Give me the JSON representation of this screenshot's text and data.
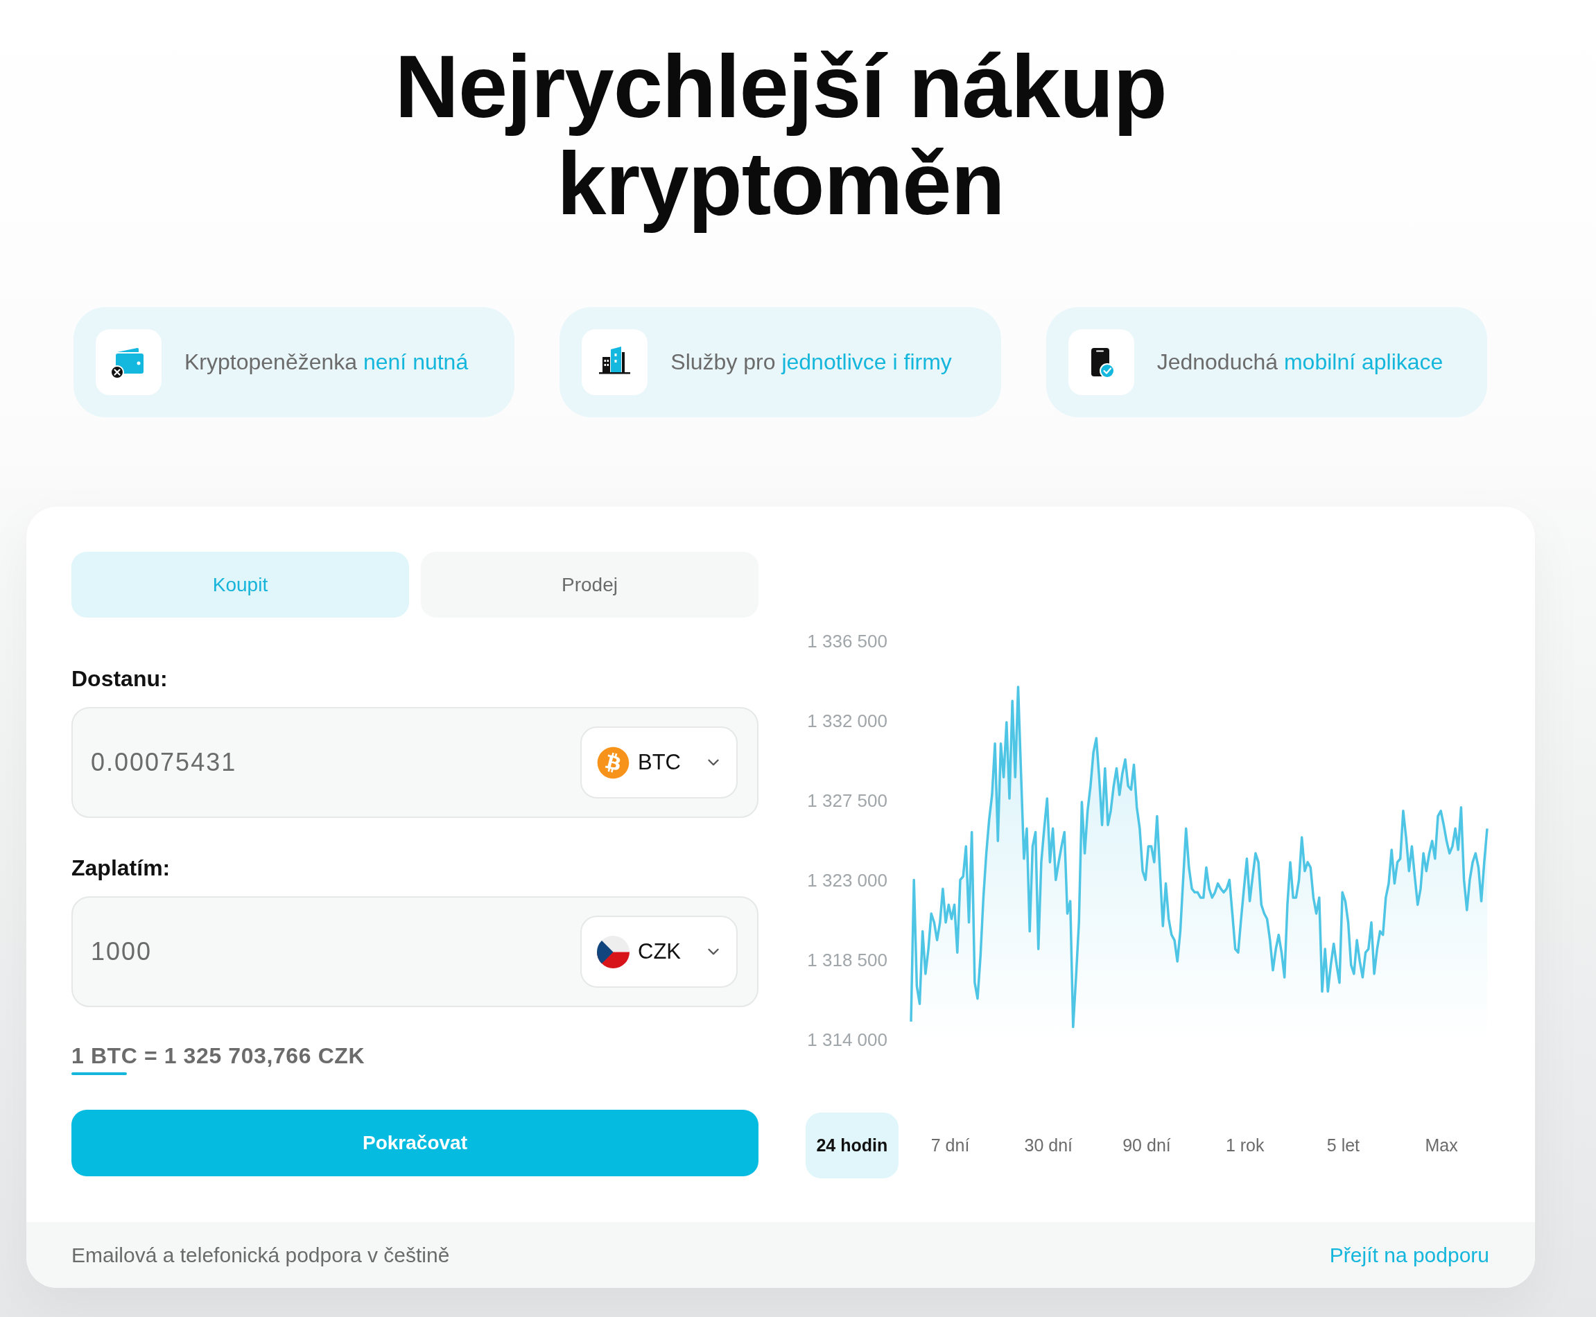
{
  "title": "Nejrychlejší nákup kryptoměn",
  "features": [
    {
      "text": "Kryptopeněženka",
      "highlight": "není nutná"
    },
    {
      "text": "Služby pro",
      "highlight": "jednotlivce i firmy"
    },
    {
      "text": "Jednoduchá",
      "highlight": "mobilní aplikace"
    }
  ],
  "trade": {
    "tabs": [
      {
        "label": "Koupit",
        "selected": true
      },
      {
        "label": "Prodej",
        "selected": false
      }
    ],
    "fields": [
      {
        "label": "Dostanu:",
        "value": "0.00075431",
        "currency": "BTC"
      },
      {
        "label": "Zaplatím:",
        "value": "1000",
        "currency": "CZK"
      }
    ],
    "rate": "1 BTC = 1 325 703,766 CZK",
    "submit": "Pokračovat"
  },
  "chart": {
    "chart_data": {
      "type": "area",
      "ylim": [
        1314000,
        1336500
      ],
      "yticks": [
        {
          "value": 1314000,
          "label": "1 314 000"
        },
        {
          "value": 1318500,
          "label": "1 318 500"
        },
        {
          "value": 1323000,
          "label": "1 323 000"
        },
        {
          "value": 1327500,
          "label": "1 327 500"
        },
        {
          "value": 1332000,
          "label": "1 332 000"
        },
        {
          "value": 1336500,
          "label": "1 336 500"
        }
      ],
      "series": [
        {
          "color": "#4ec5e4",
          "values": [
            1315100,
            1323100,
            1317100,
            1316100,
            1320200,
            1317800,
            1319200,
            1321200,
            1320700,
            1319700,
            1320700,
            1322600,
            1320700,
            1321700,
            1320900,
            1321700,
            1319000,
            1323100,
            1323300,
            1325000,
            1320700,
            1325800,
            1317300,
            1316400,
            1318800,
            1322100,
            1324600,
            1326500,
            1327900,
            1330800,
            1325300,
            1330800,
            1328900,
            1332000,
            1327700,
            1333200,
            1328900,
            1334000,
            1329100,
            1324300,
            1326000,
            1320200,
            1325000,
            1325800,
            1319200,
            1324100,
            1326000,
            1327700,
            1324100,
            1326000,
            1323100,
            1324100,
            1325000,
            1325800,
            1321200,
            1321900,
            1314800,
            1317600,
            1320700,
            1327500,
            1324600,
            1327000,
            1328400,
            1330300,
            1331100,
            1328900,
            1326200,
            1329400,
            1326200,
            1327000,
            1328400,
            1329400,
            1327900,
            1329100,
            1329900,
            1328400,
            1328200,
            1329600,
            1327200,
            1326000,
            1323600,
            1323100,
            1325000,
            1325000,
            1324100,
            1326700,
            1323600,
            1320500,
            1322900,
            1320900,
            1320000,
            1319700,
            1318500,
            1320200,
            1323100,
            1326000,
            1323800,
            1322600,
            1322400,
            1322400,
            1322100,
            1322100,
            1323800,
            1322600,
            1322100,
            1322400,
            1322900,
            1322600,
            1322400,
            1322600,
            1323100,
            1321200,
            1319200,
            1319000,
            1320900,
            1322600,
            1324300,
            1321900,
            1323300,
            1324600,
            1324100,
            1321700,
            1321200,
            1320900,
            1319700,
            1318000,
            1319200,
            1320000,
            1319000,
            1317600,
            1321700,
            1324100,
            1322100,
            1322100,
            1323100,
            1325500,
            1323600,
            1324100,
            1323800,
            1322100,
            1321200,
            1322100,
            1316800,
            1319200,
            1316800,
            1318300,
            1319500,
            1318300,
            1317300,
            1322400,
            1321900,
            1320700,
            1318300,
            1317800,
            1319700,
            1318500,
            1317600,
            1319000,
            1319200,
            1320700,
            1317800,
            1319200,
            1320200,
            1320000,
            1322100,
            1322900,
            1324800,
            1322900,
            1324100,
            1324300,
            1327000,
            1325500,
            1323600,
            1325000,
            1323300,
            1321700,
            1322600,
            1324600,
            1323600,
            1324600,
            1325300,
            1324300,
            1326700,
            1327000,
            1326200,
            1325300,
            1324600,
            1325000,
            1326000,
            1324800,
            1327200,
            1323100,
            1321400,
            1323100,
            1324100,
            1324600,
            1323800,
            1321900,
            1324100,
            1326000
          ]
        }
      ]
    },
    "ranges": [
      {
        "label": "24 hodin",
        "selected": true
      },
      {
        "label": "7 dní",
        "selected": false
      },
      {
        "label": "30 dní",
        "selected": false
      },
      {
        "label": "90 dní",
        "selected": false
      },
      {
        "label": "1 rok",
        "selected": false
      },
      {
        "label": "5 let",
        "selected": false
      },
      {
        "label": "Max",
        "selected": false
      }
    ]
  },
  "footer": {
    "text": "Emailová a telefonická podpora v češtině",
    "link": "Přejít na podporu"
  }
}
